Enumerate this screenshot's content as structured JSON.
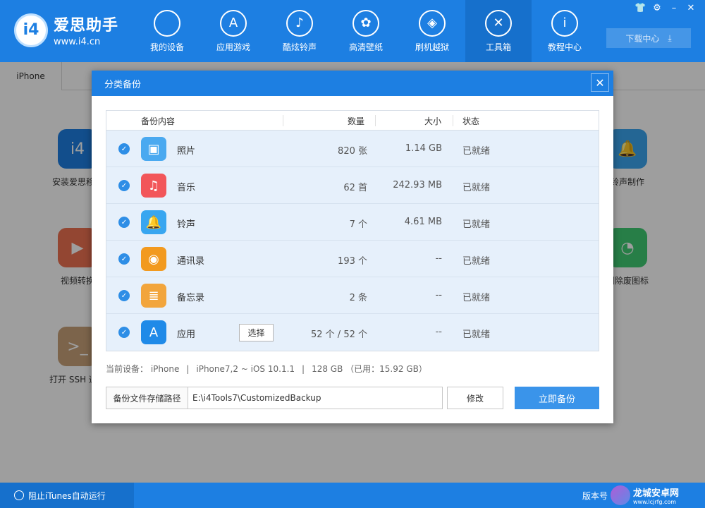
{
  "brand": {
    "title": "爱思助手",
    "url": "www.i4.cn",
    "mark": "i4"
  },
  "nav": [
    {
      "label": "我的设备",
      "icon": ""
    },
    {
      "label": "应用游戏",
      "icon": "A"
    },
    {
      "label": "酷炫铃声",
      "icon": "♪"
    },
    {
      "label": "高清壁纸",
      "icon": "✿"
    },
    {
      "label": "刷机越狱",
      "icon": "◈"
    },
    {
      "label": "工具箱",
      "icon": "✕",
      "active": true
    },
    {
      "label": "教程中心",
      "icon": "i"
    }
  ],
  "window_controls": [
    "👕",
    "⚙",
    "–",
    "✕"
  ],
  "download": {
    "label": "下载中心",
    "icon": "⤓"
  },
  "device_tab": "iPhone",
  "tools": [
    {
      "label": "安装爱思移动",
      "color": "#1d7fe2",
      "glyph": "i4"
    },
    {
      "label": "视频转换",
      "color": "#ee7152",
      "glyph": "▶"
    },
    {
      "label": "打开 SSH 通道",
      "color": "#c8a27a",
      "glyph": ">_"
    },
    {
      "label": "铃声制作",
      "color": "#3aa5ef",
      "glyph": "🔔"
    },
    {
      "label": "删除废图标",
      "color": "#3fcb73",
      "glyph": "◔"
    }
  ],
  "dialog": {
    "title": "分类备份",
    "close": "✕",
    "headers": {
      "content": "备份内容",
      "count": "数量",
      "size": "大小",
      "status": "状态"
    },
    "rows": [
      {
        "name": "照片",
        "count": "820 张",
        "size": "1.14 GB",
        "status": "已就绪",
        "icon": "photos-icon",
        "color": "#4aa9f0",
        "glyph": "▣"
      },
      {
        "name": "音乐",
        "count": "62 首",
        "size": "242.93 MB",
        "status": "已就绪",
        "icon": "music-icon",
        "color": "#f2565a",
        "glyph": "♫"
      },
      {
        "name": "铃声",
        "count": "7 个",
        "size": "4.61 MB",
        "status": "已就绪",
        "icon": "bell-icon",
        "color": "#38a6f0",
        "glyph": "🔔"
      },
      {
        "name": "通讯录",
        "count": "193 个",
        "size": "--",
        "status": "已就绪",
        "icon": "contacts-icon",
        "color": "#f29a1f",
        "glyph": "◉"
      },
      {
        "name": "备忘录",
        "count": "2 条",
        "size": "--",
        "status": "已就绪",
        "icon": "notes-icon",
        "color": "#f2a53c",
        "glyph": "≣"
      },
      {
        "name": "应用",
        "count": "52 个 / 52 个",
        "size": "--",
        "status": "已就绪",
        "icon": "app-store-icon",
        "color": "#1f8ae8",
        "glyph": "A",
        "select": "选择"
      }
    ],
    "device_info": {
      "device": "当前设备：  iPhone",
      "model": "iPhone7,2 ~ iOS 10.1.1",
      "storage": "128 GB （已用：15.92 GB）"
    },
    "path_label": "备份文件存储路径",
    "path_value": "E:\\i4Tools7\\CustomizedBackup",
    "modify": "修改",
    "backup": "立即备份"
  },
  "bottom": {
    "itunes": "阻止iTunes自动运行",
    "version": "版本号"
  },
  "watermark": {
    "title": "龙城安卓网",
    "url": "www.lcjrfg.com"
  }
}
